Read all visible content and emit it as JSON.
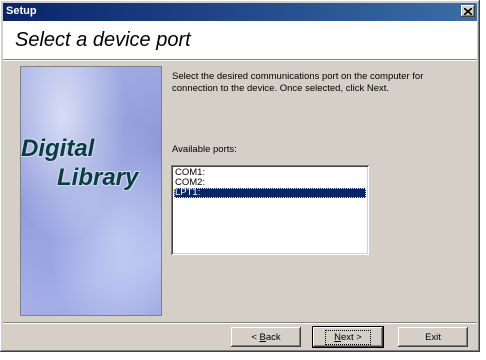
{
  "window": {
    "title": "Setup"
  },
  "heading": "Select a device port",
  "banner": {
    "line1": "Digital",
    "line2": "Library"
  },
  "description": "Select the desired communications port on the computer for connection to the device. Once selected, click Next.",
  "ports_label": "Available ports:",
  "ports": [
    {
      "label": "COM1:",
      "selected": false
    },
    {
      "label": "COM2:",
      "selected": false
    },
    {
      "label": "LPT1:",
      "selected": true
    }
  ],
  "buttons": {
    "back": {
      "accel": "B",
      "rest": "ack",
      "prefix": "< ",
      "label": "< Back"
    },
    "next": {
      "accel": "N",
      "rest": "ext >",
      "label": "Next >"
    },
    "exit": {
      "label": "Exit"
    }
  }
}
